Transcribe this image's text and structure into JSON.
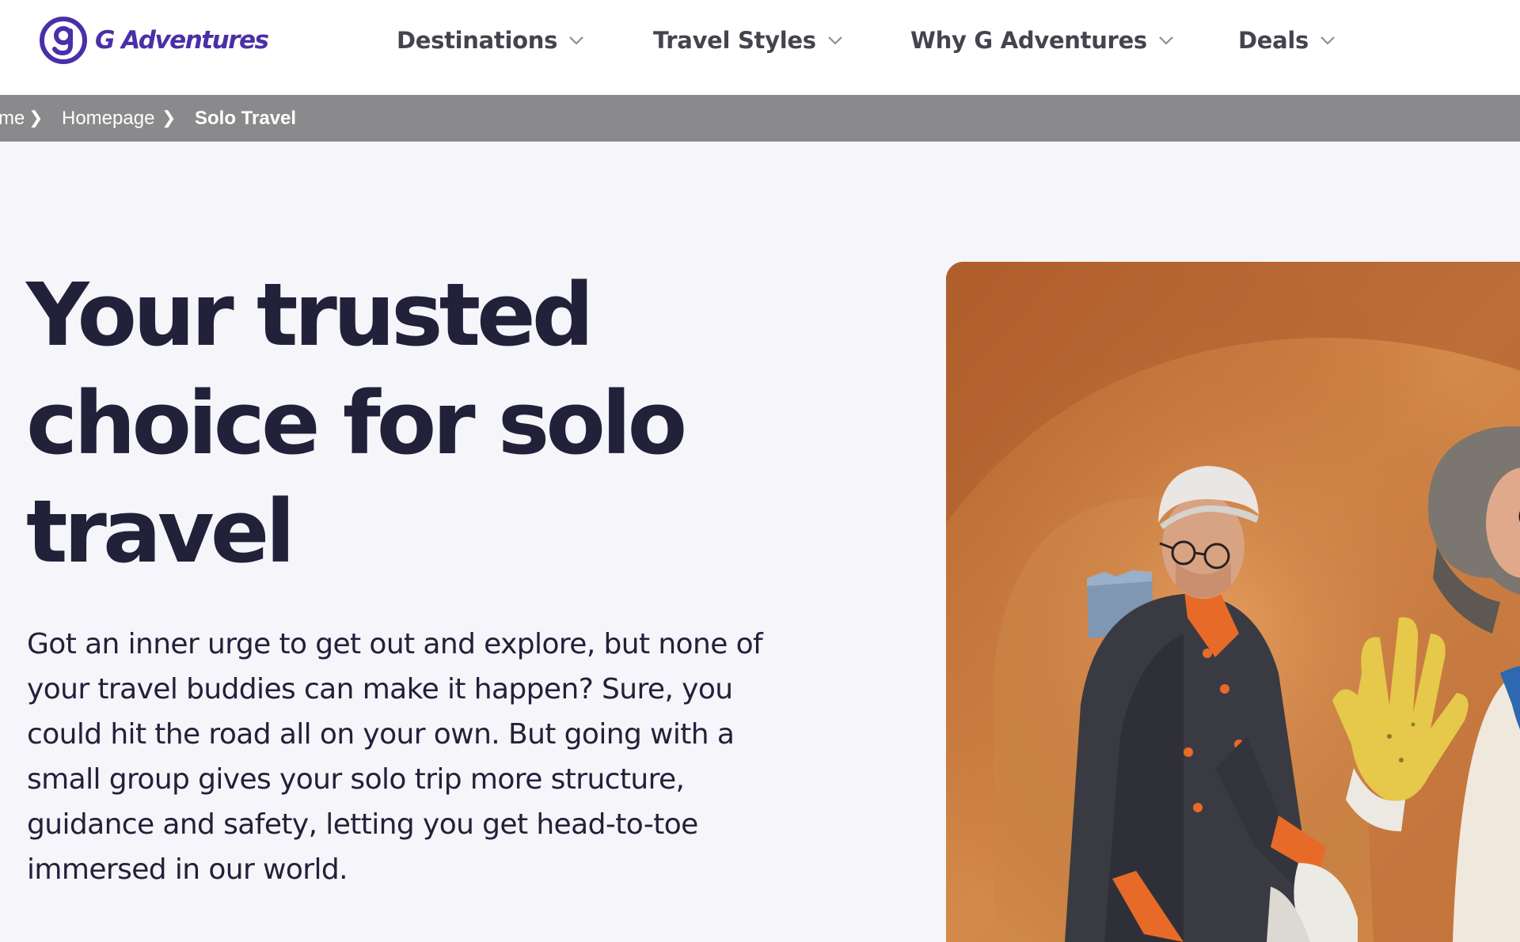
{
  "brand": {
    "name": "G Adventures",
    "color": "#4a2fa8"
  },
  "nav": {
    "items": [
      {
        "label": "Destinations",
        "icon": "chevron-down-icon"
      },
      {
        "label": "Travel Styles",
        "icon": "chevron-down-icon"
      },
      {
        "label": "Why G Adventures",
        "icon": "chevron-down-icon"
      },
      {
        "label": "Deals",
        "icon": "chevron-down-icon"
      }
    ]
  },
  "breadcrumb": {
    "items": [
      {
        "label": "me"
      },
      {
        "label": "Homepage"
      },
      {
        "label": "Solo Travel"
      }
    ],
    "separator": "❯"
  },
  "hero": {
    "title_lines": [
      "Your trusted",
      "choice for solo",
      "travel"
    ],
    "body_lines": [
      "Got an inner urge to get out and explore, but none of",
      "your travel buddies can make it happen? Sure, you",
      "could hit the road all on your own. But going with a",
      "small group gives your solo trip more structure,",
      "guidance and safety, letting you get head-to-toe",
      "immersed in our world."
    ]
  },
  "colors": {
    "page_bg": "#f5f5fa",
    "text_dark": "#22213a",
    "nav_text": "#44444f",
    "breadcrumb_bg": "#8a8a8c"
  }
}
